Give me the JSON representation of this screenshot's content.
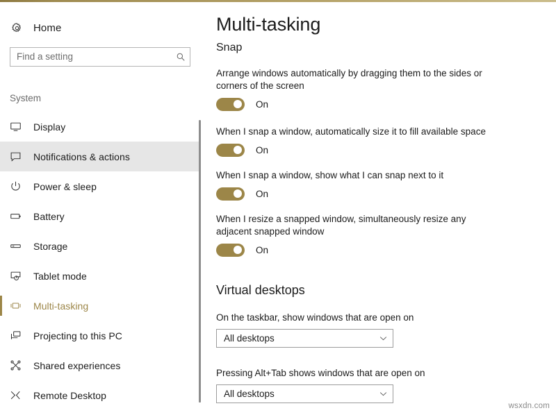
{
  "window": {
    "accent_color": "#9c8648",
    "background": "#ffffff"
  },
  "sidebar": {
    "home": {
      "label": "Home",
      "icon": "gear-icon"
    },
    "search": {
      "placeholder": "Find a setting",
      "value": "",
      "icon": "search-icon"
    },
    "section_label": "System",
    "items": [
      {
        "label": "Display",
        "icon": "monitor-icon",
        "selected": false,
        "hovered": false
      },
      {
        "label": "Notifications & actions",
        "icon": "speech-bubble-icon",
        "selected": false,
        "hovered": true
      },
      {
        "label": "Power & sleep",
        "icon": "power-icon",
        "selected": false,
        "hovered": false
      },
      {
        "label": "Battery",
        "icon": "battery-icon",
        "selected": false,
        "hovered": false
      },
      {
        "label": "Storage",
        "icon": "storage-icon",
        "selected": false,
        "hovered": false
      },
      {
        "label": "Tablet mode",
        "icon": "tablet-mode-icon",
        "selected": false,
        "hovered": false
      },
      {
        "label": "Multi-tasking",
        "icon": "task-view-icon",
        "selected": true,
        "hovered": false
      },
      {
        "label": "Projecting to this PC",
        "icon": "project-screen-icon",
        "selected": false,
        "hovered": false
      },
      {
        "label": "Shared experiences",
        "icon": "share-nodes-icon",
        "selected": false,
        "hovered": false
      },
      {
        "label": "Remote Desktop",
        "icon": "remote-desktop-icon",
        "selected": false,
        "hovered": false
      }
    ]
  },
  "main": {
    "title": "Multi-tasking",
    "snap": {
      "heading": "Snap",
      "settings": [
        {
          "description": "Arrange windows automatically by dragging them to the sides or corners of the screen",
          "state": "On",
          "on": true
        },
        {
          "description": "When I snap a window, automatically size it to fill available space",
          "state": "On",
          "on": true
        },
        {
          "description": "When I snap a window, show what I can snap next to it",
          "state": "On",
          "on": true
        },
        {
          "description": "When I resize a snapped window, simultaneously resize any adjacent snapped window",
          "state": "On",
          "on": true
        }
      ]
    },
    "virtual_desktops": {
      "heading": "Virtual desktops",
      "dropdowns": [
        {
          "label": "On the taskbar, show windows that are open on",
          "value": "All desktops"
        },
        {
          "label": "Pressing Alt+Tab shows windows that are open on",
          "value": "All desktops"
        }
      ]
    }
  },
  "watermark": "wsxdn.com"
}
